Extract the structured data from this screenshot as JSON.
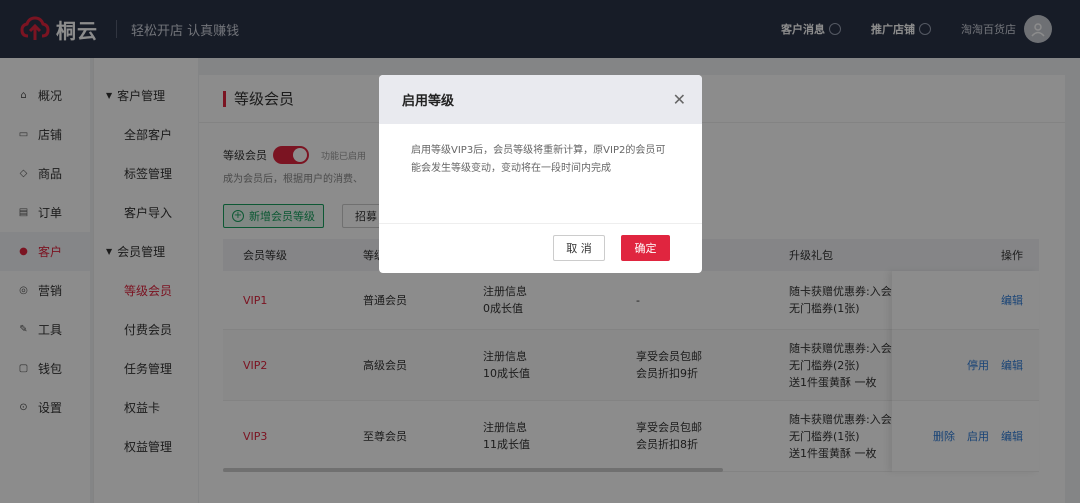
{
  "brand": {
    "name": "桐云",
    "slogan": "轻松开店 认真赚钱",
    "color": "#e0253f"
  },
  "topbar": {
    "messages": "客户消息",
    "promote": "推广店铺",
    "shop": "淘淘百货店"
  },
  "nav": [
    {
      "label": "概况",
      "icon": "home-icon"
    },
    {
      "label": "店铺",
      "icon": "store-icon"
    },
    {
      "label": "商品",
      "icon": "tag-icon"
    },
    {
      "label": "订单",
      "icon": "order-icon"
    },
    {
      "label": "客户",
      "icon": "user-icon",
      "active": true
    },
    {
      "label": "营销",
      "icon": "marketing-icon"
    },
    {
      "label": "工具",
      "icon": "tool-icon"
    },
    {
      "label": "钱包",
      "icon": "wallet-icon"
    },
    {
      "label": "设置",
      "icon": "settings-icon"
    }
  ],
  "subnav": {
    "group1": "客户管理",
    "group1_items": [
      "全部客户",
      "标签管理",
      "客户导入"
    ],
    "group2": "会员管理",
    "group2_items": [
      "等级会员",
      "付费会员",
      "任务管理",
      "权益卡",
      "权益管理"
    ]
  },
  "page": {
    "title": "等级会员",
    "toggle_label": "等级会员",
    "toggle_hint": "功能已启用",
    "desc": "成为会员后，根据用户的消费、",
    "add_button": "新增会员等级",
    "recruit_button": "招募"
  },
  "table": {
    "headers": [
      "会员等级",
      "等级",
      "",
      "",
      "升级礼包",
      "操作"
    ],
    "rows": [
      {
        "level": "VIP1",
        "name": "普通会员",
        "cond1": "注册信息",
        "cond2": "0成长值",
        "rights1": "-",
        "rights2": "",
        "gift1": "随卡获赠优惠券:入会",
        "gift2": "无门槛券(1张)",
        "gift3": "",
        "ops": [
          "编辑"
        ]
      },
      {
        "level": "VIP2",
        "name": "高级会员",
        "cond1": "注册信息",
        "cond2": "10成长值",
        "rights1": "享受会员包邮",
        "rights2": "会员折扣9折",
        "gift1": "随卡获赠优惠券:入会",
        "gift2": "无门槛券(2张)",
        "gift3": "送1件蛋黄酥 一枚",
        "ops": [
          "停用",
          "编辑"
        ]
      },
      {
        "level": "VIP3",
        "name": "至尊会员",
        "cond1": "注册信息",
        "cond2": "11成长值",
        "rights1": "享受会员包邮",
        "rights2": "会员折扣8折",
        "gift1": "随卡获赠优惠券:入会",
        "gift2": "无门槛券(1张)",
        "gift3": "送1件蛋黄酥 一枚",
        "ops": [
          "删除",
          "启用",
          "编辑"
        ]
      }
    ]
  },
  "modal": {
    "title": "启用等级",
    "body": "启用等级VIP3后，会员等级将重新计算，原VIP2的会员可能会发生等级变动，变动将在一段时间内完成",
    "cancel": "取 消",
    "ok": "确定"
  }
}
